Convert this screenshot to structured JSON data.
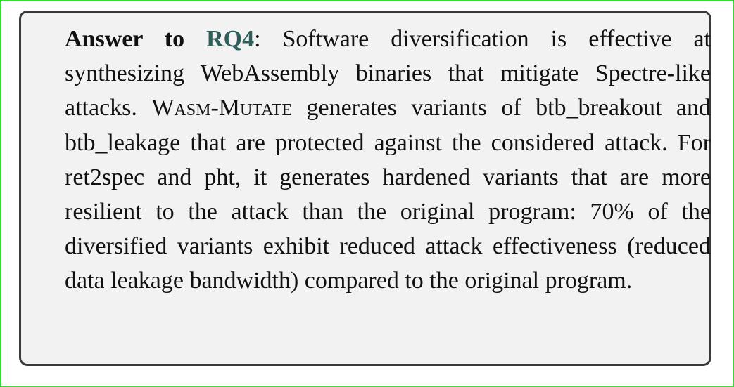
{
  "answer_box": {
    "label": "Answer to",
    "rq_ref": "RQ4",
    "colon": ":",
    "lead_in": " Software diversification is effective at synthesizing WebAssembly binaries that mitigate Spectre-like attacks. ",
    "tool_name": "Wasm-Mutate",
    "body": " generates vari­ants of btb_breakout and btb_leakage that are protected against the considered attack. For ret2spec and pht, it generates hardened variants that are more resilient to the attack than the original program: 70% of the diversified variants exhibit reduced attack effectiveness (reduced data leakage bandwidth) compared to the original program."
  },
  "colors": {
    "rq_link": "#2f5f5a",
    "box_border": "#3a3a3a",
    "box_background": "#f2f2f2",
    "outer_border": "#2fe02f"
  }
}
